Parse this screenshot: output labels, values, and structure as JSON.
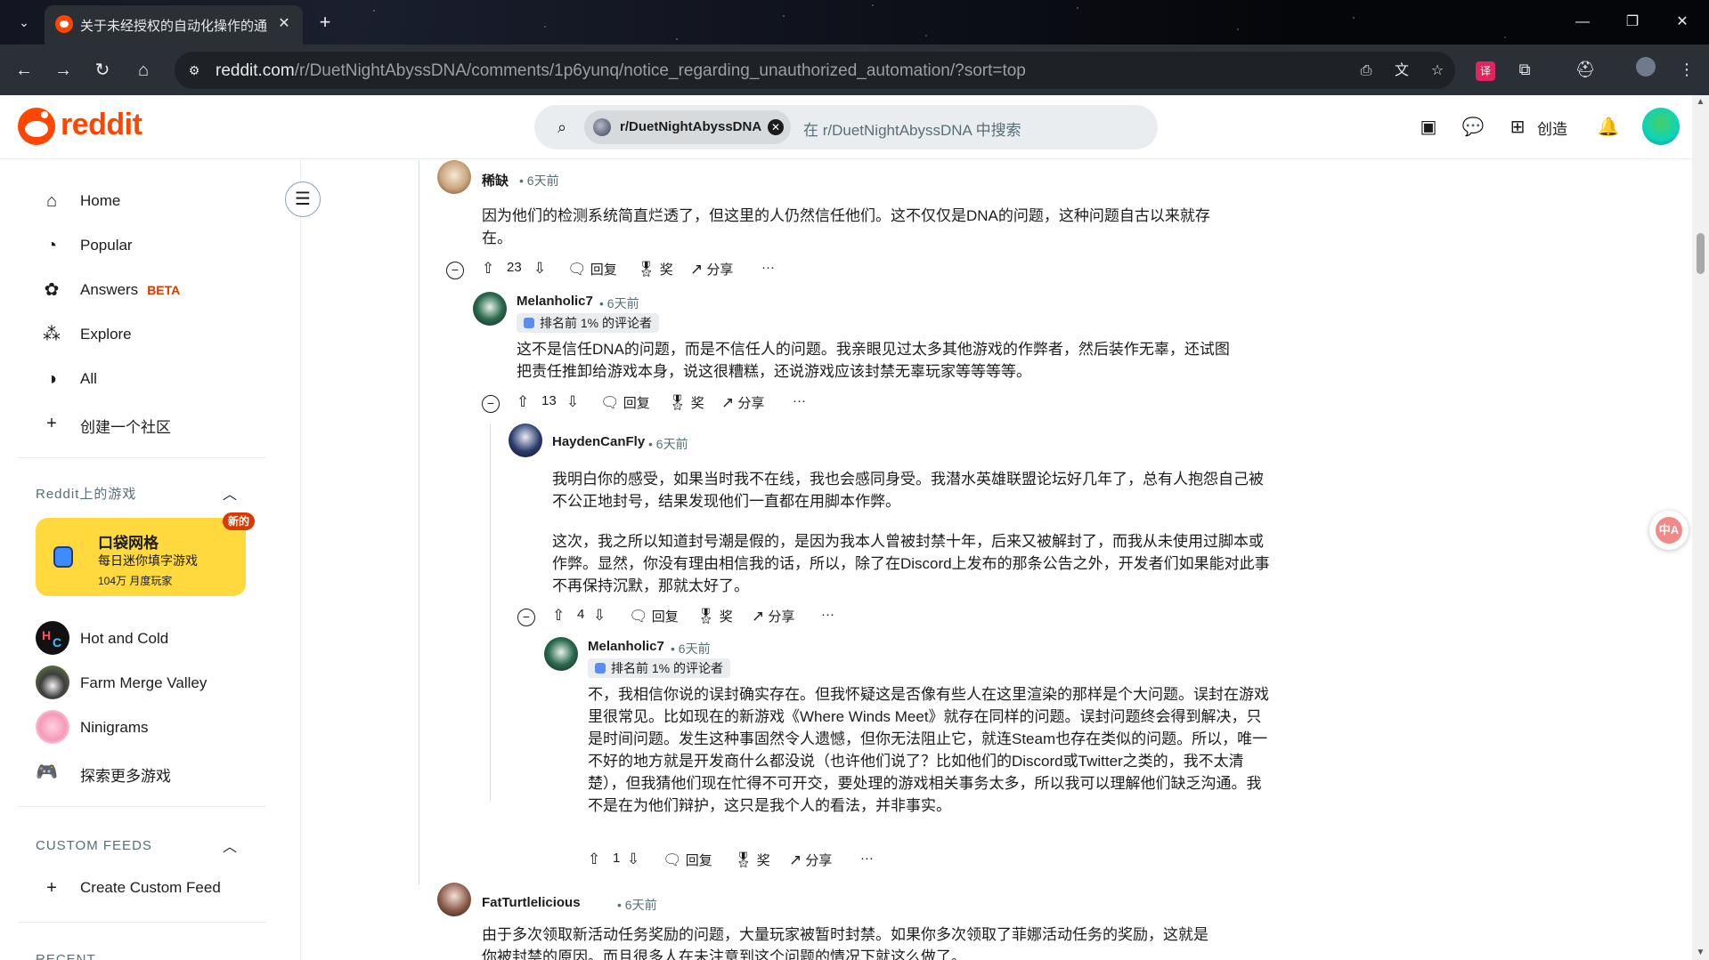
{
  "browser": {
    "tab_title": "关于未经授权的自动化操作的通知",
    "tab_close": "✕",
    "tab_new": "+",
    "url_host": "reddit.com",
    "url_path": "/r/DuetNightAbyssDNA/comments/1p6yunq/notice_regarding_unauthorized_automation/?sort=top"
  },
  "header": {
    "logo_text": "reddit",
    "search_chip": "r/DuetNightAbyssDNA",
    "search_placeholder": "在 r/DuetNightAbyssDNA 中搜索",
    "create_label": "创造"
  },
  "sidebar": {
    "nav": [
      {
        "label": "Home",
        "icon": "home-icon"
      },
      {
        "label": "Popular",
        "icon": "popular-icon"
      },
      {
        "label": "Answers",
        "icon": "answers-icon",
        "badge": "BETA"
      },
      {
        "label": "Explore",
        "icon": "explore-icon"
      },
      {
        "label": "All",
        "icon": "all-icon"
      },
      {
        "label": "创建一个社区",
        "icon": "plus-icon"
      }
    ],
    "games_title": "Reddit上的游戏",
    "promo": {
      "title": "口袋网格",
      "subtitle": "每日迷你填字游戏",
      "meta": "104万 月度玩家",
      "badge": "新的"
    },
    "games": [
      {
        "label": "Hot and Cold"
      },
      {
        "label": "Farm Merge Valley"
      },
      {
        "label": "Ninigrams"
      },
      {
        "label": "探索更多游戏"
      }
    ],
    "custom_feeds_title": "CUSTOM FEEDS",
    "create_feed": "Create Custom Feed",
    "recent_title": "RECENT"
  },
  "comments": [
    {
      "author": "稀缺",
      "time": "6天前",
      "body": [
        "因为他们的检测系统简直烂透了，但这里的人仍然信任他们。这不仅仅是DNA的问题，这种问题自古以来就存在。"
      ],
      "votes": "23"
    },
    {
      "author": "Melanholic7",
      "time": "6天前",
      "flair": "排名前 1% 的评论者",
      "body": [
        "这不是信任DNA的问题，而是不信任人的问题。我亲眼见过太多其他游戏的作弊者，然后装作无辜，还试图把责任推卸给游戏本身，说这很糟糕，还说游戏应该封禁无辜玩家等等等等。"
      ],
      "votes": "13"
    },
    {
      "author": "HaydenCanFly",
      "time": "6天前",
      "body": [
        "我明白你的感受，如果当时我不在线，我也会感同身受。我潜水英雄联盟论坛好几年了，总有人抱怨自己被不公正地封号，结果发现他们一直都在用脚本作弊。",
        "这次，我之所以知道封号潮是假的，是因为我本人曾被封禁十年，后来又被解封了，而我从未使用过脚本或作弊。显然，你没有理由相信我的话，所以，除了在Discord上发布的那条公告之外，开发者们如果能对此事不再保持沉默，那就太好了。"
      ],
      "votes": "4"
    },
    {
      "author": "Melanholic7",
      "time": "6天前",
      "flair": "排名前 1% 的评论者",
      "body": [
        "不，我相信你说的误封确实存在。但我怀疑这是否像有些人在这里渲染的那样是个大问题。误封在游戏里很常见。比如现在的新游戏《Where Winds Meet》就存在同样的问题。误封问题终会得到解决，只是时间问题。发生这种事固然令人遗憾，但你无法阻止它，就连Steam也存在类似的问题。所以，唯一不好的地方就是开发商什么都没说（也许他们说了？比如他们的Discord或Twitter之类的，我不太清楚），但我猜他们现在忙得不可开交，要处理的游戏相关事务太多，所以我可以理解他们缺乏沟通。我不是在为他们辩护，这只是我个人的看法，并非事实。"
      ],
      "votes": "1"
    },
    {
      "author": "FatTurtlelicious",
      "time": "6天前",
      "body": [
        "由于多次领取新活动任务奖励的问题，大量玩家被暂时封禁。如果你多次领取了菲娜活动任务的奖励，这就是你被封禁的原因。而且很多人在未注意到这个问题的情况下就这么做了。"
      ]
    }
  ],
  "actions": {
    "reply": "回复",
    "award": "奖",
    "share": "分享",
    "more": "···",
    "collapse": "−"
  },
  "floating": {
    "translate_label": "中A"
  },
  "colors": {
    "brand": "#ff4500",
    "promo_bg": "#ffd93d",
    "beta": "#d93a00"
  }
}
